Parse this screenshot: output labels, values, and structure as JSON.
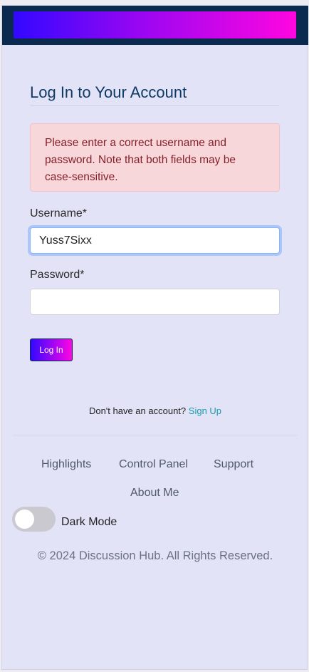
{
  "header": {
    "banner": "gradient-banner"
  },
  "login": {
    "title": "Log In to Your Account",
    "error": "Please enter a correct username and password. Note that both fields may be case-sensitive.",
    "username_label": "Username*",
    "username_value": "Yuss7Sixx",
    "password_label": "Password*",
    "password_value": "",
    "submit_label": "Log In",
    "signup_prompt": "Don't have an account?",
    "signup_link": "Sign Up"
  },
  "footer": {
    "links": [
      "Highlights",
      "Control Panel",
      "Support",
      "About Me"
    ],
    "dark_mode_label": "Dark Mode",
    "dark_mode_on": false,
    "copyright": "© 2024 Discussion Hub. All Rights Reserved."
  },
  "colors": {
    "header_bg": "#0b2a4f",
    "gradient_start": "#3208ff",
    "gradient_end": "#ff06e0",
    "page_bg": "#e3e3f8",
    "error_bg": "#f8d7da",
    "link_accent": "#1a9aa9"
  }
}
